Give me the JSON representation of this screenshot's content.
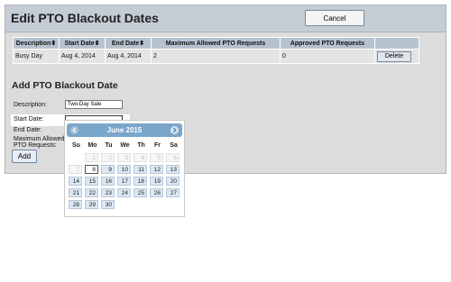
{
  "page": {
    "title": "Edit PTO Blackout Dates",
    "cancel_label": "Cancel"
  },
  "table": {
    "headers": [
      "Description",
      "Start Date",
      "End Date",
      "Maximum Allowed PTO Requests",
      "Approved PTO Requests",
      ""
    ],
    "sort_icon": "⬍",
    "rows": [
      {
        "description": "Busy Day",
        "start": "Aug 4, 2014",
        "end": "Aug 4, 2014",
        "max": "2",
        "approved": "0",
        "delete_label": "Delete"
      }
    ]
  },
  "form": {
    "title": "Add PTO Blackout Date",
    "description_label": "Description:",
    "description_value": "Two-Day Sale",
    "start_label": "Start Date:",
    "start_value": "",
    "end_label": "End Date:",
    "max_label_1": "Maximum Allowed",
    "max_label_2": "PTO Requests:",
    "add_label": "Add"
  },
  "datepicker": {
    "month": "June 2015",
    "prev_icon": "chevron-left-icon",
    "next_icon": "chevron-right-icon",
    "weekdays": [
      "Su",
      "Mo",
      "Tu",
      "We",
      "Th",
      "Fr",
      "Sa"
    ],
    "weeks": [
      [
        "",
        "1",
        "2",
        "3",
        "4",
        "5",
        "6"
      ],
      [
        "7",
        "8",
        "9",
        "10",
        "11",
        "12",
        "13"
      ],
      [
        "14",
        "15",
        "16",
        "17",
        "18",
        "19",
        "20"
      ],
      [
        "21",
        "22",
        "23",
        "24",
        "25",
        "26",
        "27"
      ],
      [
        "28",
        "29",
        "30",
        "",
        "",
        "",
        ""
      ]
    ],
    "today": "8",
    "disabled": [
      "1",
      "2",
      "3",
      "4",
      "5",
      "6",
      "7"
    ],
    "colors": {
      "header": "#7aa6cc",
      "day_bg": "#dbe7f3",
      "day_border": "#b7c7d8"
    }
  }
}
